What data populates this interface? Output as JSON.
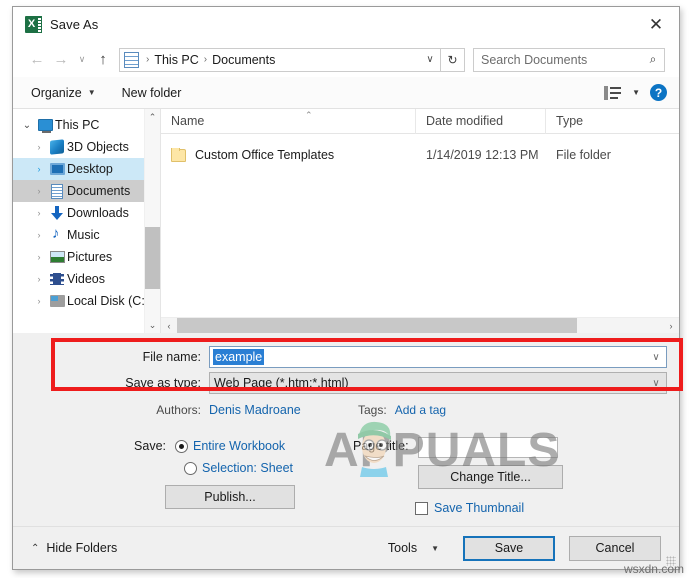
{
  "window": {
    "title": "Save As",
    "app_icon": "excel-icon",
    "close_label": "✕"
  },
  "navigation": {
    "back_icon": "←",
    "forward_icon": "→",
    "recent_icon": "∨",
    "up_icon": "↑",
    "breadcrumb_icon": "documents-folder-icon",
    "breadcrumb": [
      "This PC",
      "Documents"
    ],
    "separator": "›",
    "dropdown_icon": "∨",
    "refresh_icon": "↻",
    "search_placeholder": "Search Documents",
    "search_value": "",
    "search_icon": "⌕"
  },
  "toolbar": {
    "organize_label": "Organize",
    "organize_caret": "▼",
    "new_folder_label": "New folder",
    "view_caret": "▼",
    "help_label": "?"
  },
  "sidebar": {
    "scroll_up_icon": "⌃",
    "scroll_down_icon": "⌄",
    "items": [
      {
        "label": "This PC",
        "icon": "pc-icon",
        "twisty": "⌄",
        "level": 0,
        "state": "expanded"
      },
      {
        "label": "3D Objects",
        "icon": "3d-objects-icon",
        "twisty": "›",
        "level": 1,
        "state": "normal"
      },
      {
        "label": "Desktop",
        "icon": "desktop-icon",
        "twisty": "›",
        "level": 1,
        "state": "hover"
      },
      {
        "label": "Documents",
        "icon": "documents-icon",
        "twisty": "›",
        "level": 1,
        "state": "selected"
      },
      {
        "label": "Downloads",
        "icon": "downloads-icon",
        "twisty": "›",
        "level": 1,
        "state": "normal"
      },
      {
        "label": "Music",
        "icon": "music-icon",
        "twisty": "›",
        "level": 1,
        "state": "normal"
      },
      {
        "label": "Pictures",
        "icon": "pictures-icon",
        "twisty": "›",
        "level": 1,
        "state": "normal"
      },
      {
        "label": "Videos",
        "icon": "videos-icon",
        "twisty": "›",
        "level": 1,
        "state": "normal"
      },
      {
        "label": "Local Disk (C:)",
        "icon": "disk-icon",
        "twisty": "›",
        "level": 1,
        "state": "normal"
      }
    ]
  },
  "filelist": {
    "sort_indicator": "⌃",
    "columns": [
      "Name",
      "Date modified",
      "Type"
    ],
    "rows": [
      {
        "name": "Custom Office Templates",
        "date_modified": "1/14/2019 12:13 PM",
        "type": "File folder",
        "icon": "folder-icon"
      }
    ],
    "hscroll_left_icon": "‹",
    "hscroll_right_icon": "›"
  },
  "form": {
    "file_name_label": "File name:",
    "file_name_value": "example",
    "save_as_type_label": "Save as type:",
    "save_as_type_value": "Web Page (*.htm;*.html)",
    "combo_caret": "∨",
    "highlight_color": "#ee1c1c",
    "selection_color": "#2a7fd4"
  },
  "metadata": {
    "authors_label": "Authors:",
    "authors_value": "Denis Madroane",
    "tags_label": "Tags:",
    "tags_value": "Add a tag"
  },
  "options": {
    "save_label": "Save:",
    "radio_entire_workbook": "Entire Workbook",
    "radio_selection_sheet": "Selection: Sheet",
    "selected_radio": "Entire Workbook",
    "publish_label": "Publish...",
    "page_title_label": "Page title:",
    "page_title_value": "",
    "change_title_label": "Change Title...",
    "save_thumbnail_label": "Save Thumbnail",
    "save_thumbnail_checked": false
  },
  "footer": {
    "hide_folders_label": "Hide Folders",
    "hide_folders_caret": "⌃",
    "tools_label": "Tools",
    "tools_caret": "▼",
    "save_label": "Save",
    "cancel_label": "Cancel"
  },
  "watermarks": {
    "brand": "APPUALS",
    "site": "wsxdn.com"
  }
}
